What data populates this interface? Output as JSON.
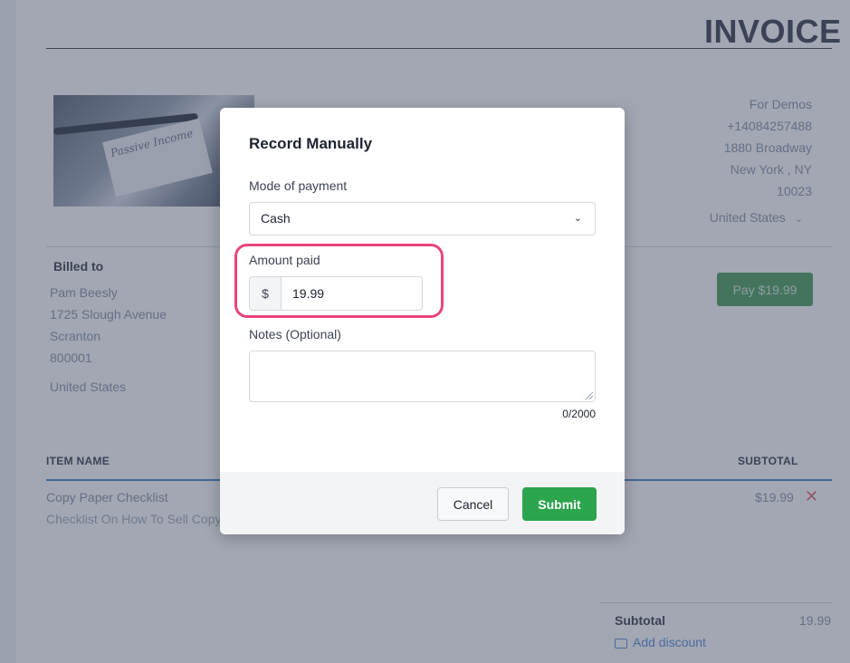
{
  "invoice": {
    "title": "INVOICE",
    "photo_caption": "Passive Income",
    "seller": {
      "name": "For Demos",
      "phone": "+14084257488",
      "address1": "1880 Broadway",
      "city_state": "New York ,  NY",
      "zip": "10023",
      "country": "United States"
    },
    "billed_to": {
      "label": "Billed to",
      "name": "Pam Beesly",
      "address": "1725 Slough Avenue",
      "city": "Scranton",
      "zip": "800001",
      "country": "United States"
    },
    "pay_button": "Pay $19.99",
    "columns": {
      "item_name": "ITEM NAME",
      "subtotal": "SUBTOTAL"
    },
    "items": [
      {
        "name": "Copy Paper Checklist",
        "description": "Checklist On How To Sell Copy Paper",
        "price": "$19.99"
      }
    ],
    "totals": {
      "subtotal_label": "Subtotal",
      "subtotal_value": "19.99",
      "add_discount": "Add discount"
    }
  },
  "modal": {
    "title": "Record Manually",
    "mode_label": "Mode of payment",
    "mode_value": "Cash",
    "amount_label": "Amount paid",
    "currency_symbol": "$",
    "amount_value": "19.99",
    "notes_label": "Notes (Optional)",
    "notes_counter": "0/2000",
    "cancel_label": "Cancel",
    "submit_label": "Submit"
  },
  "colors": {
    "submit": "#2da44e",
    "highlight": "#e8457a",
    "pay_button": "#4b9e5c",
    "remove": "#e0646e"
  }
}
